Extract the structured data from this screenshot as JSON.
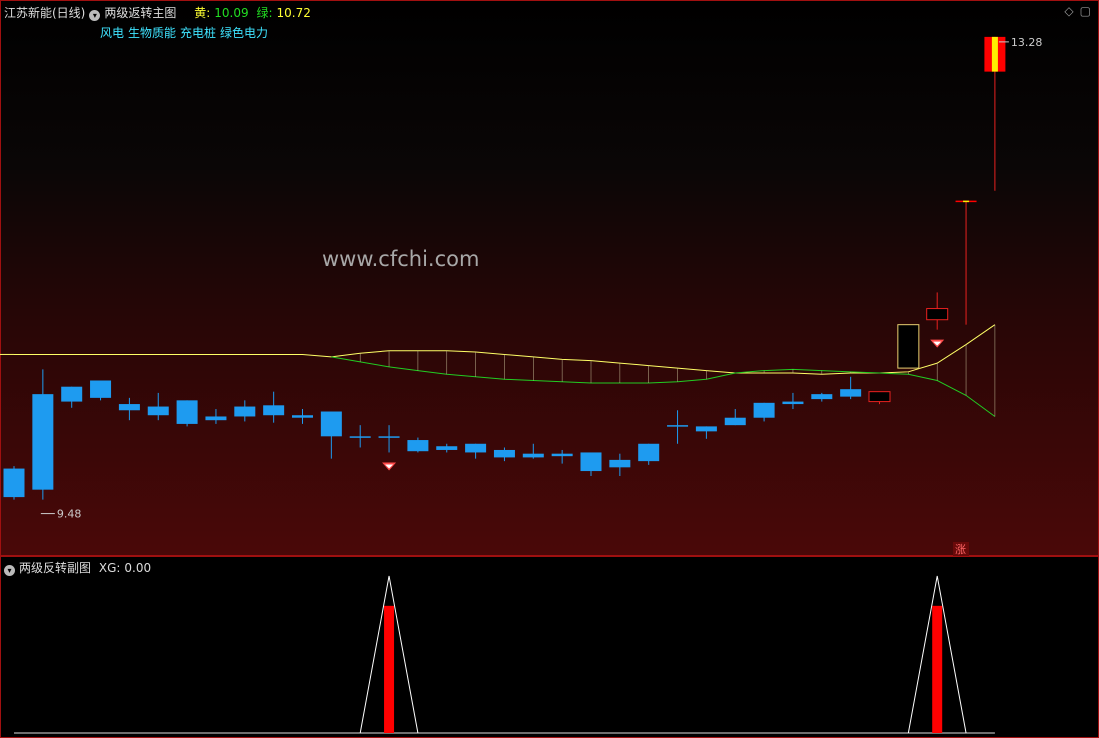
{
  "header": {
    "stock_name": "江苏新能(日线)",
    "indicator_main": "两级返转主图",
    "yellow_label": "黄:",
    "yellow_value": "10.09",
    "green_label": "绿:",
    "green_value": "10.72"
  },
  "sectors": [
    "风电",
    "生物质能",
    "充电桩",
    "绿色电力"
  ],
  "watermark": "www.cfchi.com",
  "annotations": {
    "high_label": "13.28",
    "low_label": "9.48",
    "zhang_badge": "涨"
  },
  "sub_header": {
    "indicator": "两级反转副图",
    "xg_label": "XG:",
    "xg_value": "0.00"
  },
  "colors": {
    "up_candle": "#e8211f",
    "down_candle": "#1e9bf0",
    "yellow_line": "#ffff66",
    "green_line": "#22cc22",
    "limit_fill_red": "#ff0000",
    "limit_fill_yellow": "#ffee00"
  },
  "chart_data": {
    "type": "candlestick",
    "ylim": [
      9.2,
      13.4
    ],
    "candles": [
      {
        "o": 9.8,
        "h": 9.82,
        "l": 9.55,
        "c": 9.57,
        "dir": "down"
      },
      {
        "o": 10.4,
        "h": 10.6,
        "l": 9.55,
        "c": 9.63,
        "dir": "down"
      },
      {
        "o": 10.46,
        "h": 10.46,
        "l": 10.29,
        "c": 10.34,
        "dir": "down"
      },
      {
        "o": 10.51,
        "h": 10.51,
        "l": 10.35,
        "c": 10.37,
        "dir": "down"
      },
      {
        "o": 10.32,
        "h": 10.37,
        "l": 10.19,
        "c": 10.27,
        "dir": "down"
      },
      {
        "o": 10.3,
        "h": 10.41,
        "l": 10.19,
        "c": 10.23,
        "dir": "down"
      },
      {
        "o": 10.35,
        "h": 10.35,
        "l": 10.14,
        "c": 10.16,
        "dir": "down"
      },
      {
        "o": 10.22,
        "h": 10.28,
        "l": 10.16,
        "c": 10.19,
        "dir": "down"
      },
      {
        "o": 10.3,
        "h": 10.35,
        "l": 10.18,
        "c": 10.22,
        "dir": "down"
      },
      {
        "o": 10.31,
        "h": 10.42,
        "l": 10.17,
        "c": 10.23,
        "dir": "down"
      },
      {
        "o": 10.23,
        "h": 10.28,
        "l": 10.16,
        "c": 10.21,
        "dir": "down"
      },
      {
        "o": 10.26,
        "h": 10.26,
        "l": 9.88,
        "c": 10.06,
        "dir": "down"
      },
      {
        "o": 10.06,
        "h": 10.15,
        "l": 9.97,
        "c": 10.06,
        "dir": "down"
      },
      {
        "o": 10.06,
        "h": 10.15,
        "l": 9.93,
        "c": 10.05,
        "dir": "down"
      },
      {
        "o": 10.03,
        "h": 10.05,
        "l": 9.93,
        "c": 9.94,
        "dir": "down"
      },
      {
        "o": 9.98,
        "h": 10.0,
        "l": 9.93,
        "c": 9.95,
        "dir": "down"
      },
      {
        "o": 10.0,
        "h": 10.0,
        "l": 9.88,
        "c": 9.93,
        "dir": "down"
      },
      {
        "o": 9.95,
        "h": 9.97,
        "l": 9.86,
        "c": 9.89,
        "dir": "down"
      },
      {
        "o": 9.92,
        "h": 10.0,
        "l": 9.88,
        "c": 9.89,
        "dir": "down"
      },
      {
        "o": 9.92,
        "h": 9.95,
        "l": 9.84,
        "c": 9.9,
        "dir": "down"
      },
      {
        "o": 9.93,
        "h": 9.93,
        "l": 9.74,
        "c": 9.78,
        "dir": "down"
      },
      {
        "o": 9.87,
        "h": 9.92,
        "l": 9.74,
        "c": 9.81,
        "dir": "down"
      },
      {
        "o": 10.0,
        "h": 10.0,
        "l": 9.83,
        "c": 9.86,
        "dir": "down"
      },
      {
        "o": 10.15,
        "h": 10.27,
        "l": 10.0,
        "c": 10.15,
        "dir": "down"
      },
      {
        "o": 10.14,
        "h": 10.14,
        "l": 10.04,
        "c": 10.1,
        "dir": "down"
      },
      {
        "o": 10.21,
        "h": 10.28,
        "l": 10.15,
        "c": 10.15,
        "dir": "down"
      },
      {
        "o": 10.33,
        "h": 10.33,
        "l": 10.18,
        "c": 10.21,
        "dir": "down"
      },
      {
        "o": 10.34,
        "h": 10.41,
        "l": 10.28,
        "c": 10.32,
        "dir": "down"
      },
      {
        "o": 10.4,
        "h": 10.41,
        "l": 10.34,
        "c": 10.36,
        "dir": "down"
      },
      {
        "o": 10.44,
        "h": 10.54,
        "l": 10.36,
        "c": 10.38,
        "dir": "down"
      },
      {
        "o": 10.42,
        "h": 10.42,
        "l": 10.32,
        "c": 10.34,
        "dir": "up"
      },
      {
        "o": 10.61,
        "h": 10.96,
        "l": 10.61,
        "c": 10.96,
        "dir": "up"
      },
      {
        "o": 11.0,
        "h": 11.22,
        "l": 10.92,
        "c": 11.09,
        "dir": "up"
      },
      {
        "o": 11.96,
        "h": 11.96,
        "l": 10.96,
        "c": 11.96,
        "dir": "limit"
      },
      {
        "o": 13.0,
        "h": 13.28,
        "l": 12.04,
        "c": 13.28,
        "dir": "limit"
      }
    ],
    "yellow_line": [
      10.72,
      10.72,
      10.72,
      10.72,
      10.72,
      10.72,
      10.72,
      10.72,
      10.72,
      10.72,
      10.72,
      10.7,
      10.73,
      10.75,
      10.75,
      10.75,
      10.74,
      10.72,
      10.7,
      10.68,
      10.67,
      10.65,
      10.63,
      10.61,
      10.59,
      10.57,
      10.57,
      10.57,
      10.56,
      10.57,
      10.57,
      10.58,
      10.65,
      10.8,
      10.96
    ],
    "green_line": [
      null,
      null,
      null,
      null,
      null,
      null,
      null,
      null,
      null,
      null,
      null,
      10.7,
      10.66,
      10.62,
      10.59,
      10.56,
      10.54,
      10.52,
      10.51,
      10.5,
      10.49,
      10.49,
      10.49,
      10.5,
      10.52,
      10.57,
      10.59,
      10.6,
      10.59,
      10.58,
      10.57,
      10.56,
      10.51,
      10.39,
      10.22
    ],
    "signal_markers": [
      13,
      32
    ],
    "sub_chart": {
      "xg_peaks": [
        13,
        32
      ],
      "xg_max": 1
    }
  }
}
